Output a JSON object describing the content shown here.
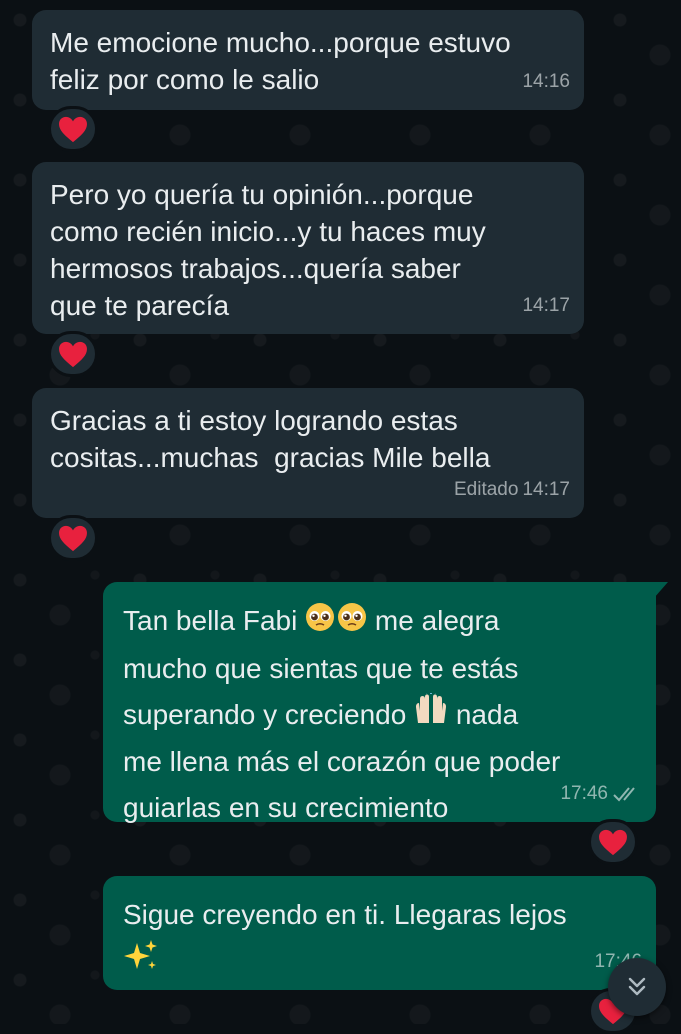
{
  "messages": [
    {
      "direction": "incoming",
      "text": "Me emocione mucho...porque estuvo\nfeliz por como le salio",
      "time": "14:16",
      "reaction": "red-heart"
    },
    {
      "direction": "incoming",
      "text": "Pero yo quería tu opinión...porque\ncomo recién inicio...y tu haces muy\nhermosos trabajos...quería saber\nque te parecía",
      "time": "14:17",
      "reaction": "red-heart"
    },
    {
      "direction": "incoming",
      "text": "Gracias a ti estoy logrando estas\ncositas...muchas  gracias Mile bella",
      "edited_label": "Editado",
      "time": "14:17",
      "reaction": "red-heart"
    },
    {
      "direction": "outgoing",
      "text_parts": [
        "Tan bella Fabi ",
        " me alegra",
        "mucho que sientas que te estás",
        "superando y creciendo ",
        " nada",
        "me llena más el corazón que poder",
        "guiarlas en su crecimiento"
      ],
      "emojis": [
        "pleading-face",
        "pleading-face",
        "raising-hands"
      ],
      "time": "17:46",
      "status": "read-double-check",
      "reaction": "red-heart"
    },
    {
      "direction": "outgoing",
      "text": "Sigue creyendo en ti. Llegaras lejos",
      "emojis": [
        "sparkles"
      ],
      "time": "17:46",
      "reaction": "red-heart"
    }
  ],
  "colors": {
    "incoming_bubble": "#1f2c34",
    "outgoing_bubble": "#005c4b",
    "background": "#0b1014",
    "text": "#e9edef",
    "heart": "#e8213e"
  },
  "scroll_button": {
    "icon": "double-chevron-down-icon"
  }
}
